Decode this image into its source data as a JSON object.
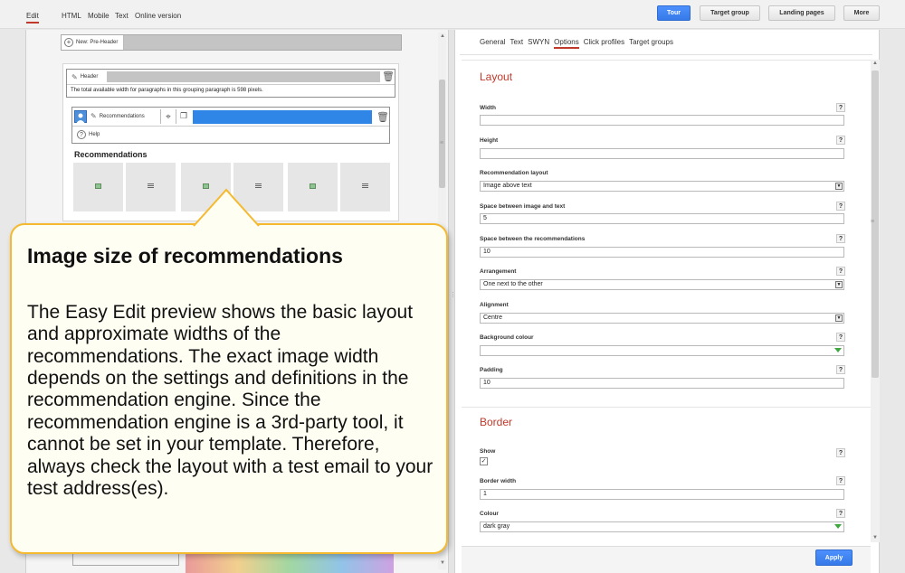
{
  "topbar": {
    "tabs": [
      "Edit",
      "HTML",
      "Mobile",
      "Text",
      "Online version"
    ],
    "buttons": {
      "tour": "Tour",
      "target_group": "Target group",
      "landing_pages": "Landing pages",
      "more": "More"
    },
    "accent_color": "#4d90fe"
  },
  "editor": {
    "preheader_label": "New: Pre-Header",
    "header_label": "Header",
    "header_note": "The total available width for paragraphs in this grouping paragraph is 598 pixels.",
    "recommendations_label": "Recommendations",
    "help_label": "Help",
    "recommendations_title": "Recommendations"
  },
  "callout": {
    "title": "Image size of recommendations",
    "body": "The Easy Edit preview shows the basic layout and approximate widths of the recommendations. The exact image width depends on the settings and definitions in the recommendation engine. Since the recommendation engine is a 3rd-party tool, it cannot be set in your template. Therefore, always check the layout with a test email to your test address(es).",
    "border_color": "#f5b92f"
  },
  "settings": {
    "tabs": [
      "General",
      "Text",
      "SWYN",
      "Options",
      "Click profiles",
      "Target groups"
    ],
    "active_tab": "Options",
    "layout": {
      "title": "Layout",
      "width_label": "Width",
      "width_value": "",
      "height_label": "Height",
      "height_value": "",
      "rec_layout_label": "Recommendation layout",
      "rec_layout_value": "Image above text",
      "space_image_text_label": "Space between image and text",
      "space_image_text_value": "5",
      "space_recs_label": "Space between the recommendations",
      "space_recs_value": "10",
      "arrangement_label": "Arrangement",
      "arrangement_value": "One next to the other",
      "alignment_label": "Alignment",
      "alignment_value": "Centre",
      "bg_colour_label": "Background colour",
      "bg_colour_value": "",
      "padding_label": "Padding",
      "padding_value": "10"
    },
    "border": {
      "title": "Border",
      "show_label": "Show",
      "show_checked": "✓",
      "border_width_label": "Border width",
      "border_width_value": "1",
      "colour_label": "Colour",
      "colour_value": "dark gray"
    },
    "help_glyph": "?",
    "apply_label": "Apply",
    "section_title_color": "#c0392b"
  }
}
